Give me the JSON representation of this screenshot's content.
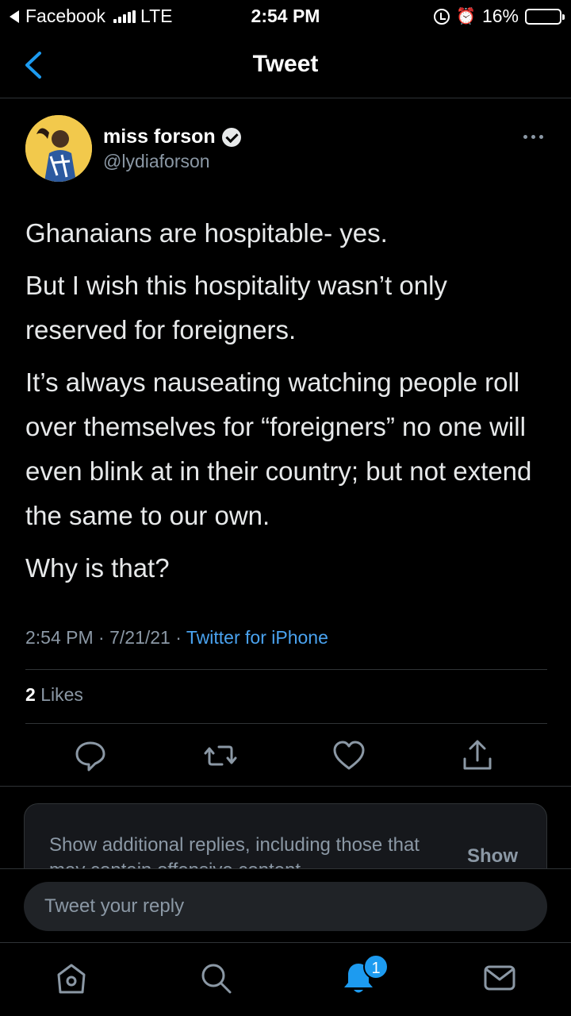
{
  "status_bar": {
    "back_app": "Facebook",
    "network": "LTE",
    "time": "2:54 PM",
    "battery": "16%",
    "battery_level": 0.16
  },
  "header": {
    "title": "Tweet"
  },
  "tweet": {
    "author_name": "miss forson",
    "author_handle": "@lydiaforson",
    "paragraphs": [
      "Ghanaians are hospitable- yes.",
      "But I wish this hospitality wasn’t only reserved for foreigners.",
      "It’s always nauseating watching people roll over themselves for “foreigners” no one will even blink at in their country; but not extend the same to our own.",
      "Why is that?"
    ],
    "time": "2:54 PM",
    "date": "7/21/21",
    "source": "Twitter for iPhone",
    "likes_count": "2",
    "likes_label": "Likes"
  },
  "additional_replies": {
    "text": "Show additional replies, including those that may contain offensive content",
    "show_label": "Show"
  },
  "composer": {
    "placeholder": "Tweet your reply"
  },
  "tab_bar": {
    "notifications_badge": "1"
  },
  "colors": {
    "accent": "#1d9bf0",
    "link": "#4aa3f0",
    "secondary_text": "#8b98a5",
    "battery": "#ffd60a"
  }
}
